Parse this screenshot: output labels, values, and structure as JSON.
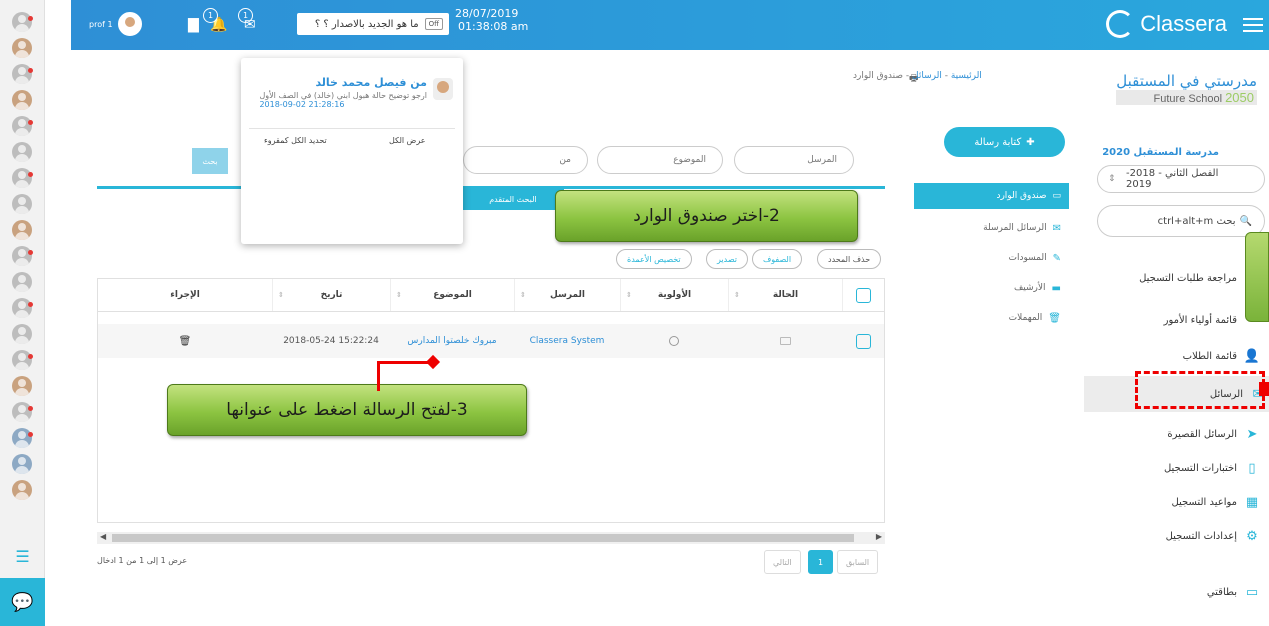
{
  "header": {
    "brand": "Classera",
    "date": "28/07/2019",
    "time": "01:38:08 am",
    "news_label": "ما هو الجديد بالاصدار ؟ ؟",
    "news_toggle": "Off",
    "user_label": "prof 1",
    "notif_badge": "1",
    "msg_badge": "1"
  },
  "sidebar": {
    "school_title": "مدرستي في المستقبل",
    "school_sub": "Future School",
    "school_year": "2050",
    "section_label": "مدرسة المستقبل 2020",
    "term_value": "الفصل الثاني - 2018-2019",
    "search_placeholder": "ctrl+alt+m بحث",
    "items": [
      {
        "label": "مراجعة طلبات التسجيل",
        "icon": "clipboard-icon"
      },
      {
        "label": "قائمة أولياء الأمور",
        "icon": "parents-icon"
      },
      {
        "label": "قائمة الطلاب",
        "icon": "students-icon"
      },
      {
        "label": "الرسائل",
        "icon": "envelope-icon"
      },
      {
        "label": "الرسائل القصيرة",
        "icon": "paper-plane-icon"
      },
      {
        "label": "اختبارات التسجيل",
        "icon": "document-icon"
      },
      {
        "label": "مواعيد التسجيل",
        "icon": "calendar-icon"
      },
      {
        "label": "إعدادات التسجيل",
        "icon": "gear-icon"
      },
      {
        "label": "بطاقتي",
        "icon": "card-icon"
      }
    ]
  },
  "breadcrumb": {
    "home": "الرئيسية",
    "messages": "الرسائل",
    "current": "صندوق الوارد"
  },
  "mail": {
    "compose": "كتابة رسالة",
    "folders": {
      "inbox": "صندوق الوارد",
      "sent": "الرسائل المرسلة",
      "drafts": "المسودات",
      "archive": "الأرشيف",
      "trash": "المهملات"
    },
    "filters": {
      "sender": "المرسل",
      "subject": "الموضوع",
      "from": "من",
      "search_button": "بحث",
      "advanced": "البحث المتقدم"
    },
    "actions": {
      "delete_selected": "حذف المحدد",
      "rows": "الصفوف",
      "export": "تصدير",
      "customize": "تخصيص الأعمدة"
    },
    "columns": {
      "status": "الحالة",
      "priority": "الأولوية",
      "sender": "المرسل",
      "subject": "الموضوع",
      "date": "تاريخ",
      "action": "الإجراء"
    },
    "rows": [
      {
        "sender": "Classera System",
        "subject": "مبروك خلصتوا المدارس",
        "date": "2018-05-24 15:22:24"
      }
    ],
    "showing": "عرض 1 إلى 1 من 1 ادخال",
    "pagination": {
      "prev": "السابق",
      "page": "1",
      "next": "التالي"
    }
  },
  "popup": {
    "from": "من فيصل محمد خالد",
    "text": "ارجو توضيح حالة هبول ابني (خالد) في الصف الأول",
    "date": "2018-09-02 21:28:16",
    "view_all": "عرض الكل",
    "mark_all": "تحديد الكل كمقروء",
    "tip": "من"
  },
  "callouts": {
    "step2": "2-اختر صندوق الوارد",
    "step3": "3-لفتح الرسالة اضغط على عنوانها"
  }
}
